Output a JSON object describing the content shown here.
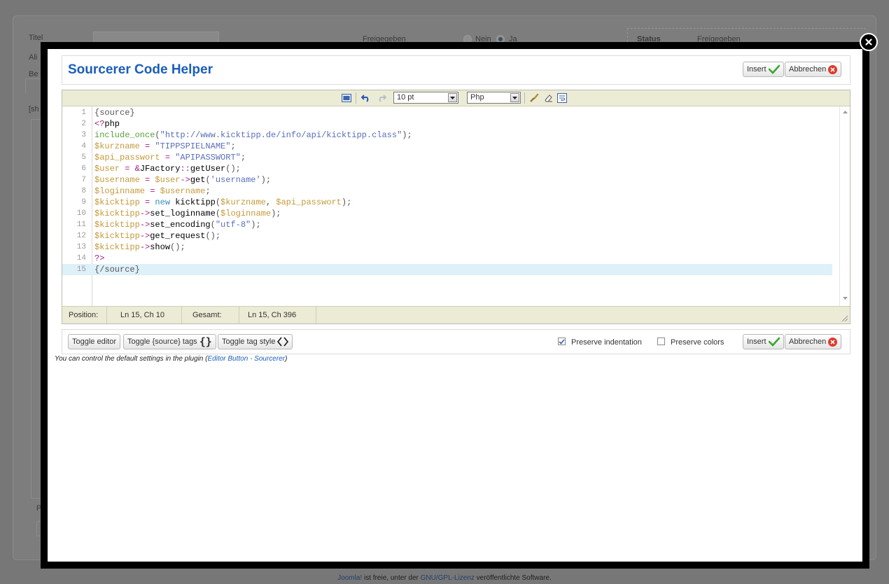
{
  "background_page": {
    "title_label": "Titel",
    "alias_label": "Ali",
    "beschreibung_label": "Be",
    "section_label": "[sh",
    "p_label": "P",
    "freigegeben_label": "Freigegeben",
    "radio_no": "Nein",
    "radio_yes": "Ja",
    "status_label": "Status",
    "status_value": "Freigegeben",
    "footer": {
      "link1": "Joomla!",
      "text1": " ist freie, unter der ",
      "link2": "GNU/GPL-Lizenz",
      "text2": " veröffentlichte Software."
    }
  },
  "modal": {
    "title": "Sourcerer Code Helper",
    "insert_label": "Insert",
    "cancel_label": "Abbrechen",
    "toolbar": {
      "font_size": "10 pt",
      "language": "Php"
    },
    "code_lines": [
      {
        "n": "1",
        "text": "{source}"
      },
      {
        "n": "2",
        "text": "<?php"
      },
      {
        "n": "3",
        "text": "include_once(\"http://www.kicktipp.de/info/api/kicktipp.class\");"
      },
      {
        "n": "4",
        "text": "$kurzname = \"TIPPSPIELNAME\";"
      },
      {
        "n": "5",
        "text": "$api_passwort = \"APIPASSWORT\";"
      },
      {
        "n": "6",
        "text": "$user = &JFactory::getUser();"
      },
      {
        "n": "7",
        "text": "$username = $user->get('username');"
      },
      {
        "n": "8",
        "text": "$loginname = $username;"
      },
      {
        "n": "9",
        "text": "$kicktipp = new kicktipp($kurzname, $api_passwort);"
      },
      {
        "n": "10",
        "text": "$kicktipp->set_loginname($loginname);"
      },
      {
        "n": "11",
        "text": "$kicktipp->set_encoding(\"utf-8\");"
      },
      {
        "n": "12",
        "text": "$kicktipp->get_request();"
      },
      {
        "n": "13",
        "text": "$kicktipp->show();"
      },
      {
        "n": "14",
        "text": "?>"
      },
      {
        "n": "15",
        "text": "{/source}"
      }
    ],
    "status": {
      "position_label": "Position:",
      "position_value": "Ln 15, Ch 10",
      "total_label": "Gesamt:",
      "total_value": "Ln 15, Ch 396"
    },
    "bottom": {
      "toggle_editor": "Toggle editor",
      "toggle_source_tags": "Toggle {source} tags",
      "toggle_tag_style": "Toggle tag style",
      "preserve_indentation": "Preserve indentation",
      "preserve_indentation_checked": true,
      "preserve_colors": "Preserve colors",
      "preserve_colors_checked": false
    },
    "note": {
      "text": "You can control the default settings in the plugin (",
      "link": "Editor Button - Sourcerer",
      "end": ")"
    }
  },
  "colors": {
    "title": "#1b5eb9",
    "toolbar_bg": "#ecebd5",
    "active_line": "#def0f8",
    "overlay": "#000000"
  }
}
